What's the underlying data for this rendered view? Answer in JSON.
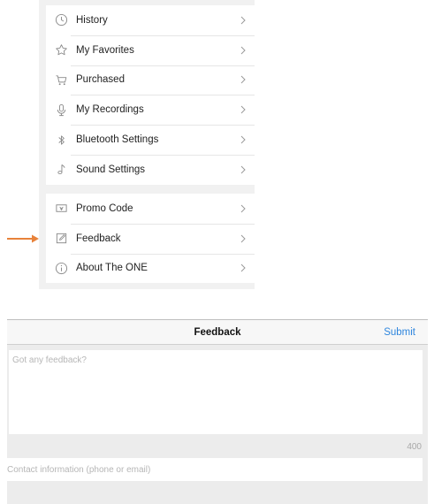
{
  "menu": {
    "group1": [
      {
        "label": "History",
        "icon": "clock-icon"
      },
      {
        "label": "My Favorites",
        "icon": "star-icon"
      },
      {
        "label": "Purchased",
        "icon": "cart-icon"
      },
      {
        "label": "My Recordings",
        "icon": "microphone-icon"
      },
      {
        "label": "Bluetooth Settings",
        "icon": "bluetooth-icon"
      },
      {
        "label": "Sound Settings",
        "icon": "music-note-icon"
      }
    ],
    "group2": [
      {
        "label": "Promo Code",
        "icon": "ticket-icon"
      },
      {
        "label": "Feedback",
        "icon": "edit-icon"
      },
      {
        "label": "About The ONE",
        "icon": "info-icon"
      }
    ]
  },
  "pointer": {
    "color": "#e8823a",
    "icon": "arrow-right-icon"
  },
  "feedback": {
    "title": "Feedback",
    "submit_label": "Submit",
    "text_placeholder": "Got any feedback?",
    "text_value": "",
    "char_count": "400",
    "contact_placeholder": "Contact information (phone or email)",
    "contact_value": ""
  },
  "colors": {
    "accent": "#2f86de",
    "pointer": "#e8823a"
  }
}
